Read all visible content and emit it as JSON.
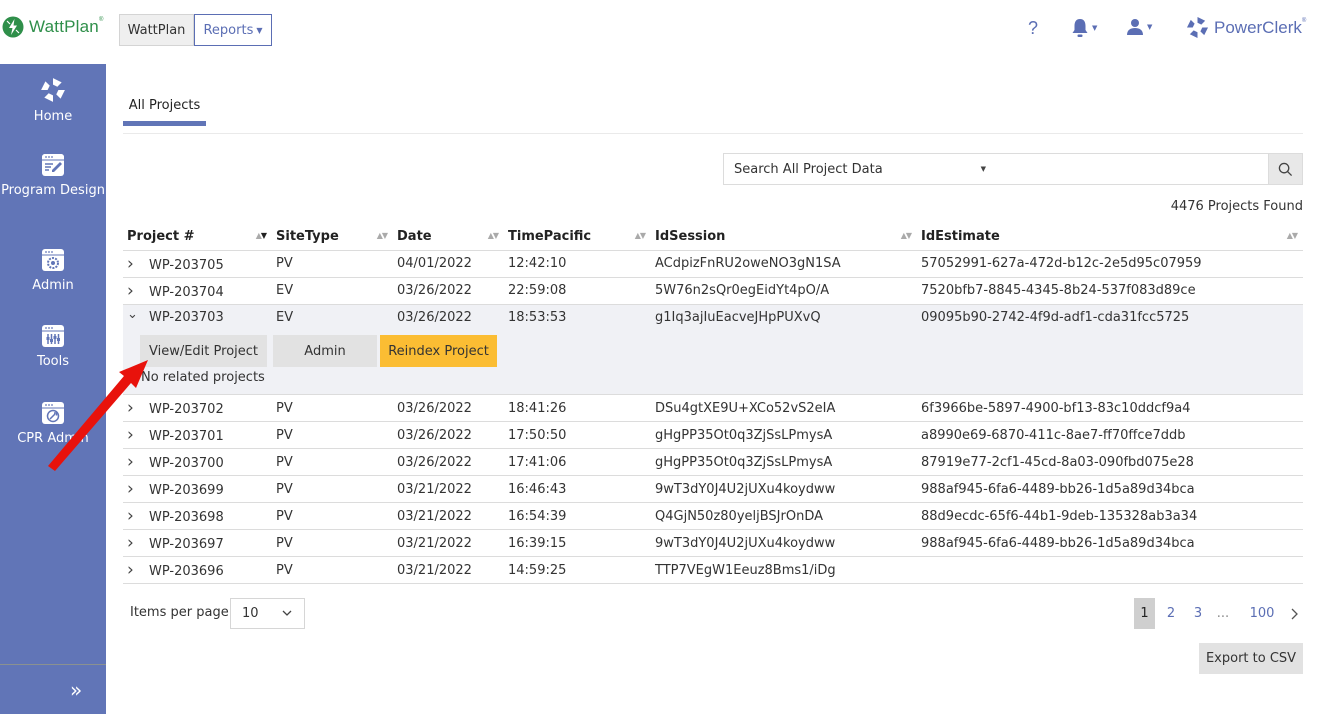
{
  "header": {
    "logo_text": "WattPlan",
    "nav": {
      "wattplan_label": "WattPlan",
      "reports_label": "Reports"
    },
    "help_label": "?",
    "brand_text": "PowerClerk",
    "brand_color": "#5b6eb4",
    "logo_color": "#2f8f4a"
  },
  "sidebar": {
    "items": [
      {
        "label": "Home",
        "icon": "home-ring-icon"
      },
      {
        "label": "Program Design",
        "icon": "program-design-icon"
      },
      {
        "label": "Admin",
        "icon": "admin-gear-icon"
      },
      {
        "label": "Tools",
        "icon": "tools-sliders-icon"
      },
      {
        "label": "CPR Admin",
        "icon": "cpr-admin-wrench-icon"
      }
    ],
    "expand_glyph": "»",
    "bg_color": "#6175b7"
  },
  "main": {
    "tab_label": "All Projects",
    "search": {
      "scope_selected": "Search All Project Data",
      "query_value": "",
      "query_placeholder": ""
    },
    "results_count": "4476 Projects Found",
    "columns": [
      "Project #",
      "SiteType",
      "Date",
      "TimePacific",
      "IdSession",
      "IdEstimate"
    ],
    "rows": [
      {
        "project": "WP-203705",
        "site_type": "PV",
        "date": "04/01/2022",
        "time": "12:42:10",
        "id_session": "ACdpizFnRU2oweNO3gN1SA",
        "id_estimate": "57052991-627a-472d-b12c-2e5d95c07959"
      },
      {
        "project": "WP-203704",
        "site_type": "EV",
        "date": "03/26/2022",
        "time": "22:59:08",
        "id_session": "5W76n2sQr0egEidYt4pO/A",
        "id_estimate": "7520bfb7-8845-4345-8b24-537f083d89ce"
      },
      {
        "project": "WP-203703",
        "site_type": "EV",
        "date": "03/26/2022",
        "time": "18:53:53",
        "id_session": "g1Iq3ajIuEacveJHpPUXvQ",
        "id_estimate": "09095b90-2742-4f9d-adf1-cda31fcc5725"
      },
      {
        "project": "WP-203702",
        "site_type": "PV",
        "date": "03/26/2022",
        "time": "18:41:26",
        "id_session": "DSu4gtXE9U+XCo52vS2eIA",
        "id_estimate": "6f3966be-5897-4900-bf13-83c10ddcf9a4"
      },
      {
        "project": "WP-203701",
        "site_type": "PV",
        "date": "03/26/2022",
        "time": "17:50:50",
        "id_session": "gHgPP35Ot0q3ZjSsLPmysA",
        "id_estimate": "a8990e69-6870-411c-8ae7-ff70ffce7ddb"
      },
      {
        "project": "WP-203700",
        "site_type": "PV",
        "date": "03/26/2022",
        "time": "17:41:06",
        "id_session": "gHgPP35Ot0q3ZjSsLPmysA",
        "id_estimate": "87919e77-2cf1-45cd-8a03-090fbd075e28"
      },
      {
        "project": "WP-203699",
        "site_type": "PV",
        "date": "03/21/2022",
        "time": "16:46:43",
        "id_session": "9wT3dY0J4U2jUXu4koydww",
        "id_estimate": "988af945-6fa6-4489-bb26-1d5a89d34bca"
      },
      {
        "project": "WP-203698",
        "site_type": "PV",
        "date": "03/21/2022",
        "time": "16:54:39",
        "id_session": "Q4GjN50z80yeljBSJrOnDA",
        "id_estimate": "88d9ecdc-65f6-44b1-9deb-135328ab3a34"
      },
      {
        "project": "WP-203697",
        "site_type": "PV",
        "date": "03/21/2022",
        "time": "16:39:15",
        "id_session": "9wT3dY0J4U2jUXu4koydww",
        "id_estimate": "988af945-6fa6-4489-bb26-1d5a89d34bca"
      },
      {
        "project": "WP-203696",
        "site_type": "PV",
        "date": "03/21/2022",
        "time": "14:59:25",
        "id_session": "TTP7VEgW1Eeuz8Bms1/iDg",
        "id_estimate": ""
      }
    ],
    "expanded_row_index": 2,
    "expanded_actions": {
      "view_edit_label": "View/Edit Project",
      "admin_label": "Admin",
      "reindex_label": "Reindex Project",
      "no_related_text": "No related projects",
      "reindex_color": "#fbbd33"
    },
    "items_per_page_label": "Items per page:",
    "items_per_page_value": "10",
    "pagination": {
      "current": "1",
      "pages": [
        "1",
        "2",
        "3",
        "...",
        "100"
      ],
      "next_glyph": "›"
    },
    "export_label": "Export to CSV"
  },
  "annotation": {
    "arrow_color": "#e8120c",
    "arrow_target": "View/Edit Project"
  }
}
